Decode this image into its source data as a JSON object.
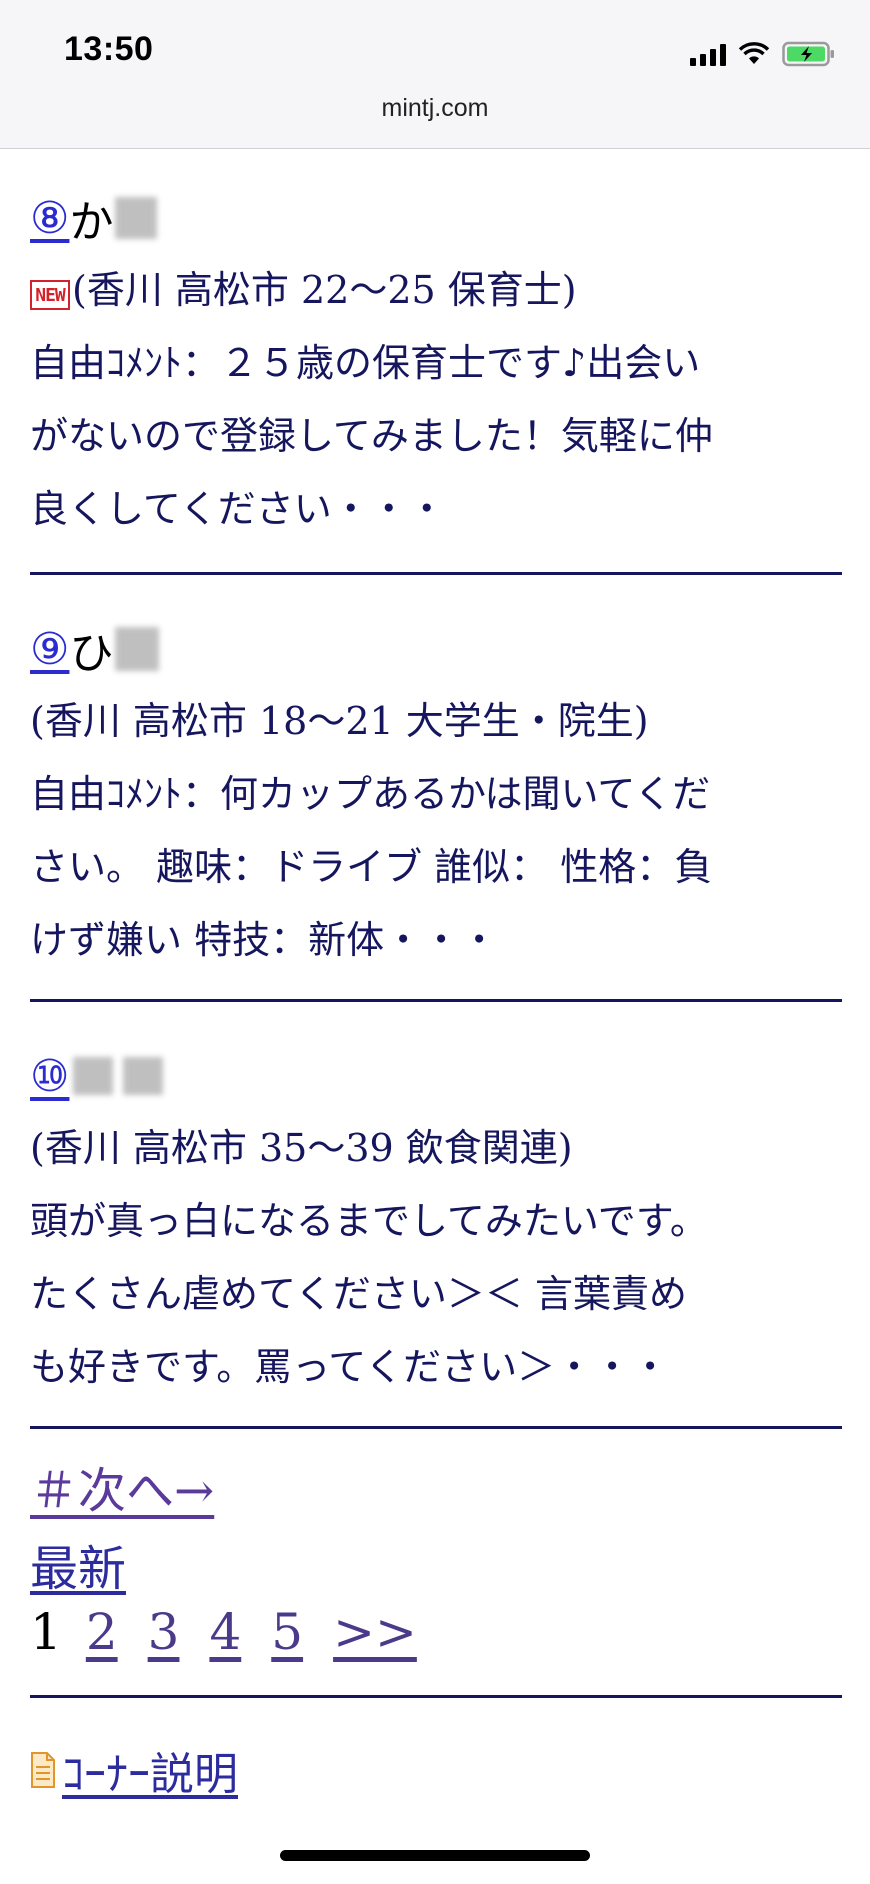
{
  "status": {
    "time": "13:50",
    "url": "mintj.com"
  },
  "entries": [
    {
      "number": "⑧",
      "initial": "か",
      "is_new": true,
      "meta": "(香川 高松市 22〜25 保育士)",
      "comment_lines": [
        "自由ｺﾒﾝﾄ：２５歳の保育士です♪出会い",
        "がないので登録してみました！気軽に仲",
        "良くしてください・・・"
      ]
    },
    {
      "number": "⑨",
      "initial": "ひ",
      "is_new": false,
      "meta": "(香川 高松市 18〜21 大学生・院生)",
      "comment_lines": [
        "自由ｺﾒﾝﾄ：何カップあるかは聞いてくだ",
        "さい。 趣味：ドライブ 誰似： 性格：負",
        "けず嫌い 特技：新体・・・"
      ]
    },
    {
      "number": "⑩",
      "initial": "",
      "is_new": false,
      "meta": "(香川 高松市 35〜39 飲食関連)",
      "comment_lines": [
        "頭が真っ白になるまでしてみたいです。",
        "たくさん虐めてください＞＜ 言葉責め",
        "も好きです。罵ってください＞・・・"
      ]
    }
  ],
  "nav": {
    "next": "＃次へ→",
    "latest": "最新",
    "current_page": "1",
    "pages": [
      "2",
      "3",
      "4",
      "5"
    ],
    "more": ">>",
    "corner": "ｺｰﾅｰ説明"
  },
  "colors": {
    "text": "#16165e",
    "link": "#2b2bd0",
    "visited": "#5a3a9a",
    "badge": "#d3232a"
  }
}
